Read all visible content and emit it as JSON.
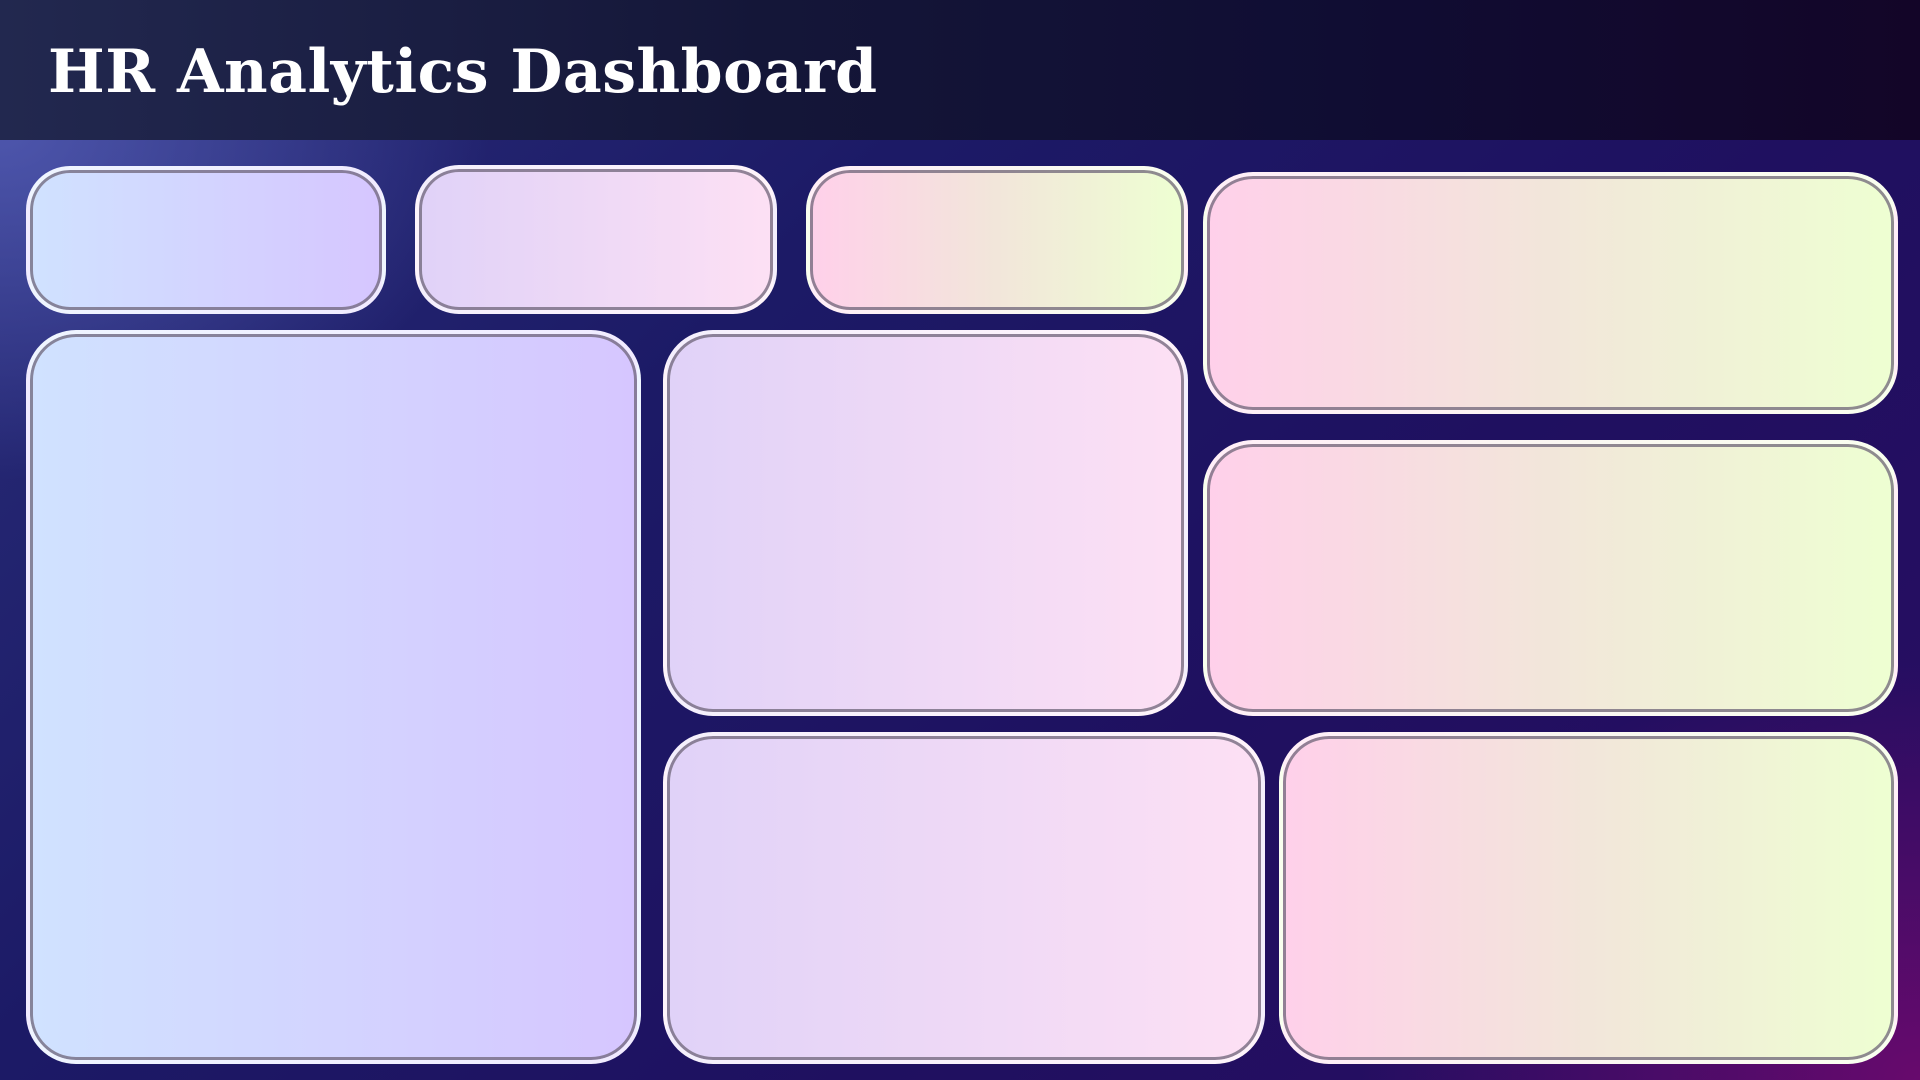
{
  "header": {
    "title": "HR Analytics Dashboard"
  },
  "colors": {
    "header_bg": "#141638",
    "title_text": "#ffffff",
    "panel_blue_purple": [
      "#d0e2ff",
      "#d6c6ff"
    ],
    "panel_lavender_pink": [
      "#e0d2f8",
      "#fde0f4"
    ],
    "panel_pink_lime": [
      "#ffd0ea",
      "#eeffd2"
    ]
  }
}
